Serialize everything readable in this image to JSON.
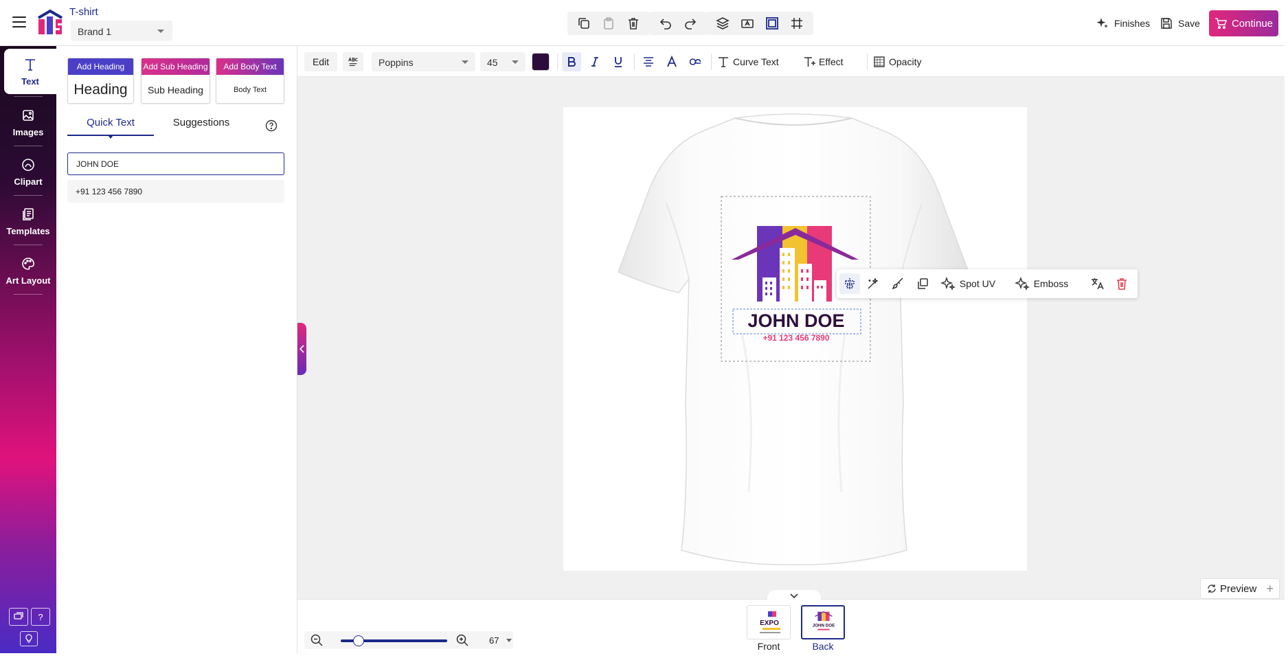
{
  "header": {
    "doc_title": "T-shirt",
    "brand": "Brand 1",
    "finishes_label": "Finishes",
    "save_label": "Save",
    "continue_label": "Continue"
  },
  "rail": {
    "items": [
      {
        "label": "Text",
        "icon": "text-icon"
      },
      {
        "label": "Images",
        "icon": "image-icon"
      },
      {
        "label": "Clipart",
        "icon": "clipart-icon"
      },
      {
        "label": "Templates",
        "icon": "templates-icon"
      },
      {
        "label": "Art Layout",
        "icon": "palette-icon"
      }
    ],
    "help_label": "?"
  },
  "panel": {
    "cards": [
      {
        "header": "Add Heading",
        "body": "Heading",
        "color": "#4b3fc8"
      },
      {
        "header": "Add Sub Heading",
        "body": "Sub Heading",
        "color": "#d9318a"
      },
      {
        "header": "Add Body Text",
        "body": "Body Text",
        "color": "#d9318a"
      }
    ],
    "tabs": [
      "Quick Text",
      "Suggestions"
    ],
    "quick_text": [
      "JOHN DOE",
      "+91 123 456 7890"
    ]
  },
  "text_toolbar": {
    "edit_label": "Edit",
    "font": "Poppins",
    "size": "45",
    "color": "#2d0d3c",
    "curve_label": "Curve Text",
    "effect_label": "Effect",
    "opacity_label": "Opacity"
  },
  "canvas": {
    "name_text": "JOHN DOE",
    "phone_text": "+91 123 456 7890"
  },
  "float_bar": {
    "spot_uv_label": "Spot UV",
    "emboss_label": "Emboss"
  },
  "preview_label": "Preview",
  "zoom": {
    "value": "67",
    "level": 0.13
  },
  "pages": [
    {
      "label": "Front",
      "thumb_line1": "EXPO"
    },
    {
      "label": "Back",
      "thumb_line1": "JOHN DOE"
    }
  ],
  "colors": {
    "accent": "#1c2a8a",
    "brand_pink": "#e0287b",
    "brand_purple": "#9b2a9c",
    "logo_purple": "#6a35b8",
    "logo_yellow": "#f2c230",
    "logo_pink": "#e83a78"
  }
}
